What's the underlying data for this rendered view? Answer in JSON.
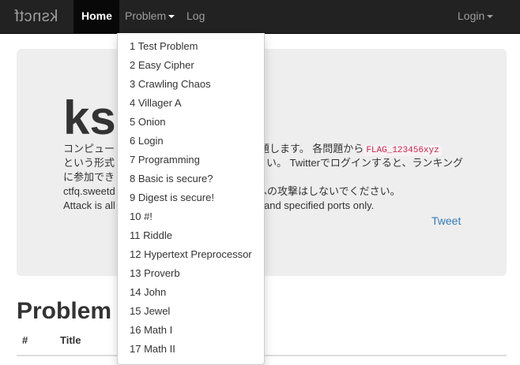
{
  "navbar": {
    "brand": "ksnctf",
    "home": "Home",
    "problem": "Problem",
    "log": "Log",
    "login": "Login"
  },
  "jumbotron": {
    "title": "ks",
    "line1_left": "コンピュー",
    "line1_right": "出題します。 各問題から",
    "flag": "FLAG_123456xyz",
    "line2_left": "という形式",
    "line2_right": "い。 Twitterでログインすると、ランキング",
    "line3_left": "に参加でき",
    "line4_left": "ctfq.sweetd",
    "line4_right": "への攻撃はしないでください。",
    "line5_left": "Attack is all",
    "line5_right": "and specified ports only.",
    "tweet": "Tweet"
  },
  "problems": {
    "heading": "Problem",
    "col_num": "#",
    "col_title": "Title"
  },
  "dropdown": {
    "items": [
      "1 Test Problem",
      "2 Easy Cipher",
      "3 Crawling Chaos",
      "4 Villager A",
      "5 Onion",
      "6 Login",
      "7 Programming",
      "8 Basic is secure?",
      "9 Digest is secure!",
      "10 #!",
      "11 Riddle",
      "12 Hypertext Preprocessor",
      "13 Proverb",
      "14 John",
      "15 Jewel",
      "16 Math I",
      "17 Math II"
    ]
  }
}
